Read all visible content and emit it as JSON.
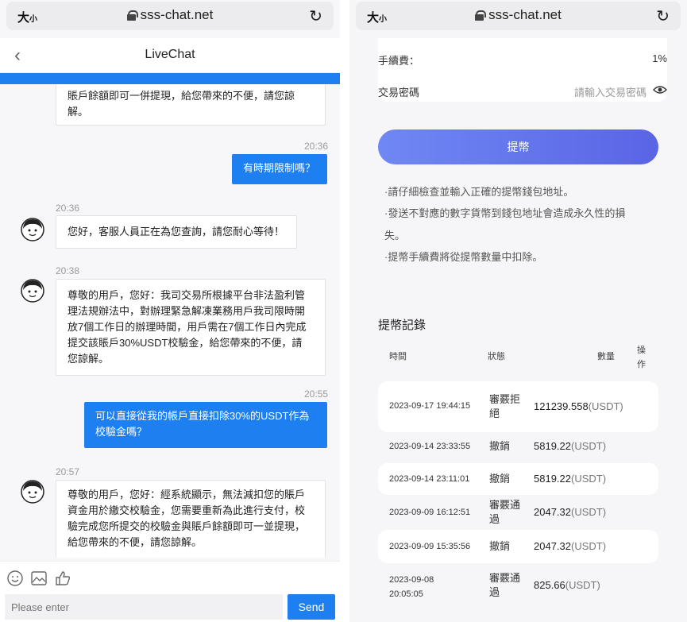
{
  "left": {
    "browser": {
      "size_big": "大",
      "size_small": "小",
      "url": "sss-chat.net"
    },
    "header": {
      "title": "LiveChat"
    },
    "messages": {
      "m0": {
        "lines": [
          "賬戶餘額即可一併提現，給您帶來的不便，請您諒",
          "解。"
        ]
      },
      "t1": "20:36",
      "m1": {
        "text": "有時期限制嗎？"
      },
      "t2": "20:36",
      "m2": {
        "text": "您好，客服人員正在為您查詢，請您耐心等待！"
      },
      "t3": "20:38",
      "m3": {
        "lines": [
          "尊敬的用戶，您好：我司交易所根據平台非法盈利管",
          "理法規辦法中，對辦理緊急解凍業務用戶我司限時開",
          "放7個工作日的辦理時間，用戶需在7個工作日內完成",
          "提交該賬戶30%USDT校驗金，給您帶來的不便，請",
          "您諒解。"
        ]
      },
      "t4": "20:55",
      "m4": {
        "lines": [
          "可以直接從我的帳戶直接扣除30%的USDT作為",
          "校驗金嗎？"
        ]
      },
      "t5": "20:57",
      "m5": {
        "lines": [
          "尊敬的用戶，您好：經系統顯示，無法減扣您的賬戶",
          "資金用於繳交校驗金，您需要重新為此進行支付，校",
          "驗完成您所提交的校驗金與賬戶餘額即可一並提現，",
          "給您帶來的不便，請您諒解。"
        ]
      }
    },
    "footer": {
      "placeholder": "Please enter",
      "send_label": "Send"
    }
  },
  "right": {
    "browser": {
      "size_big": "大",
      "size_small": "小",
      "url": "sss-chat.net"
    },
    "fee_label": "手續費：",
    "fee_value": "1%",
    "pwd_label": "交易密碼",
    "pwd_placeholder": "請輸入交易密碼",
    "withdraw_label": "提幣",
    "notes": [
      "·請仔細檢查並輸入正確的提幣錢包地址。",
      "·發送不對應的數字貨幣到錢包地址會造成永久性的損",
      "失。",
      "·提幣手續費將從提幣數量中扣除。"
    ],
    "records_title": "提幣記錄",
    "columns": {
      "time": "時間",
      "status": "狀態",
      "amount": "數量",
      "op1": "操",
      "op2": "作"
    },
    "records": [
      {
        "time": "2023-09-17 19:44:15",
        "time2": "",
        "status1": "審覈拒",
        "status2": "絕",
        "amount": "121239.558",
        "unit": "(USDT)"
      },
      {
        "time": "2023-09-14 23:33:55",
        "time2": "",
        "status1": "撤銷",
        "status2": "",
        "amount": "5819.22",
        "unit": "(USDT)"
      },
      {
        "time": "2023-09-14 23:11:01",
        "time2": "",
        "status1": "撤銷",
        "status2": "",
        "amount": "5819.22",
        "unit": "(USDT)"
      },
      {
        "time": "2023-09-09 16:12:51",
        "time2": "",
        "status1": "審覈通",
        "status2": "過",
        "amount": "2047.32",
        "unit": "(USDT)"
      },
      {
        "time": "2023-09-09 15:35:56",
        "time2": "",
        "status1": "撤銷",
        "status2": "",
        "amount": "2047.32",
        "unit": "(USDT)"
      },
      {
        "time": "2023-09-08",
        "time2": "20:05:05",
        "status1": "審覈通",
        "status2": "過",
        "amount": "825.66",
        "unit": "(USDT)"
      }
    ]
  }
}
